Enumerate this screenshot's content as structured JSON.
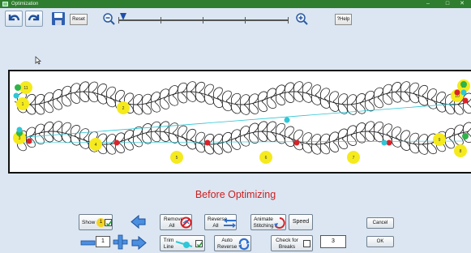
{
  "window": {
    "title": "Optimization",
    "minimize": "–",
    "maximize": "□",
    "close": "✕"
  },
  "toolbar": {
    "reset_label": "Reset",
    "help_label": "?Help",
    "icons": [
      "undo-icon",
      "redo-icon",
      "save-icon",
      "zoom-out-icon",
      "zoom-in-icon"
    ]
  },
  "canvas": {
    "markers": [
      {
        "label": "1"
      },
      {
        "label": "2"
      },
      {
        "label": "3"
      },
      {
        "label": "4"
      },
      {
        "label": "5"
      },
      {
        "label": "6"
      },
      {
        "label": "7"
      },
      {
        "label": "8"
      },
      {
        "label": "9"
      },
      {
        "label": "10"
      },
      {
        "label": "11"
      },
      {
        "label": "12"
      }
    ],
    "colors": {
      "marker": "#f5ea1d",
      "start": "#2fb34a",
      "stop": "#d9232a",
      "jump": "#2ec7d6",
      "jump_line": "#29c4d4"
    }
  },
  "caption": "Before Optimizing",
  "controls": {
    "show_label": "Show",
    "show_badge": "1",
    "remove_all": [
      "Remove",
      "All"
    ],
    "reverse_all": [
      "Reverse",
      "All"
    ],
    "animate_stitching": [
      "Animate",
      "Stitching"
    ],
    "speed": "Speed",
    "cancel": "Cancel",
    "ok": "OK",
    "index_value": "1",
    "trim_line": [
      "Trim",
      "Line"
    ],
    "auto_reverse": [
      "Auto",
      "Reverse"
    ],
    "check_for_breaks": [
      "Check for",
      "Breaks"
    ],
    "breaks_value": "3"
  }
}
